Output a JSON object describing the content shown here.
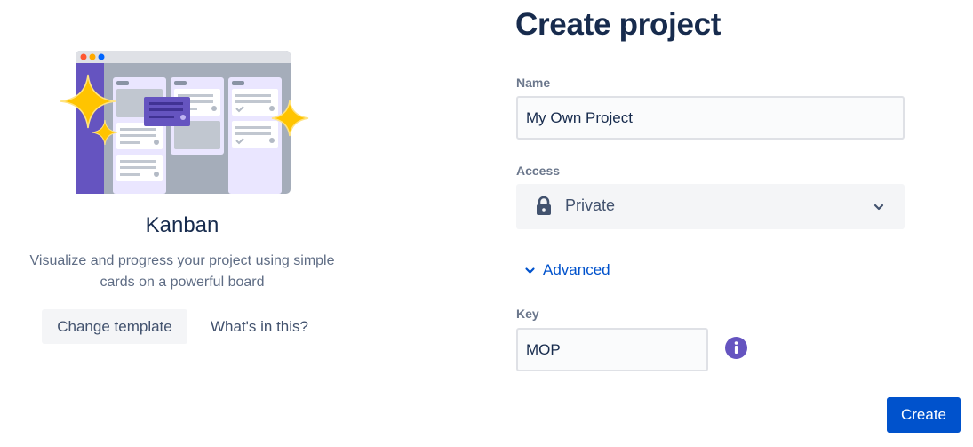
{
  "template": {
    "name": "Kanban",
    "description_line1": "Visualize and progress your project using simple",
    "description_line2": "cards on a powerful board",
    "change_template_label": "Change template",
    "whats_in_this_label": "What's in this?"
  },
  "form": {
    "title": "Create project",
    "name": {
      "label": "Name",
      "value": "My Own Project"
    },
    "access": {
      "label": "Access",
      "value": "Private",
      "icon": "lock-icon"
    },
    "advanced_label": "Advanced",
    "key": {
      "label": "Key",
      "value": "MOP",
      "info_icon": "info-icon"
    },
    "create_label": "Create"
  },
  "colors": {
    "primary": "#0052cc",
    "title_text": "#172b4d",
    "muted_text": "#5e6c84",
    "info_purple": "#6554c0",
    "illustration_purple": "#6554c0",
    "sparkle_yellow": "#ffc400"
  }
}
